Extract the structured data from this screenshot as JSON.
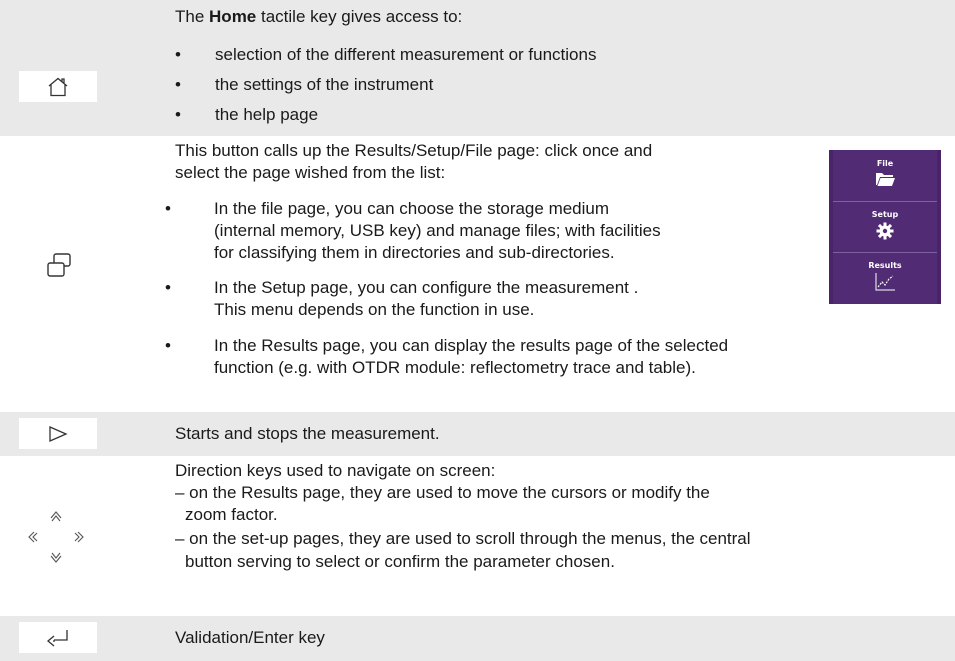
{
  "home": {
    "intro_prefix": "The ",
    "intro_bold": "Home",
    "intro_suffix": " tactile key gives access to:",
    "bullets": [
      "selection of the different measurement or functions",
      "the settings of the instrument",
      "the help page"
    ]
  },
  "results_setup_file": {
    "line1": "This button calls up the Results/Setup/File page: click once and",
    "line2": "select the page wished from the list:",
    "bullets": [
      {
        "lines": [
          "In the file page, you can choose the storage medium",
          "(internal memory, USB key) and manage files; with facilities",
          "for classifying them in directories and sub-directories."
        ]
      },
      {
        "lines": [
          "In the Setup page, you can configure the measurement .",
          "This menu depends on the function in use."
        ]
      },
      {
        "lines": [
          "In the Results page, you can display the results page of the selected",
          "function (e.g. with OTDR module: reflectometry trace and table)."
        ]
      }
    ],
    "side_menu": {
      "items": [
        "File",
        "Setup",
        "Results"
      ],
      "icons": [
        "folder-icon",
        "gear-icon",
        "chart-icon"
      ],
      "colors": {
        "background": "#512b74",
        "frame": "#4a2368",
        "divider": "#7d61a0"
      }
    }
  },
  "start_stop": {
    "text": "Starts and stops the measurement."
  },
  "direction": {
    "line1": "Direction keys used to navigate on screen:",
    "line2": "– on the Results page, they are used to move the cursors or modify the",
    "line3": "zoom factor.",
    "line4": "– on the set-up pages, they are used to scroll through the menus, the central",
    "line5": "button serving to select or confirm the parameter chosen."
  },
  "enter": {
    "text": "Validation/Enter key"
  },
  "bullet_glyph": "•"
}
